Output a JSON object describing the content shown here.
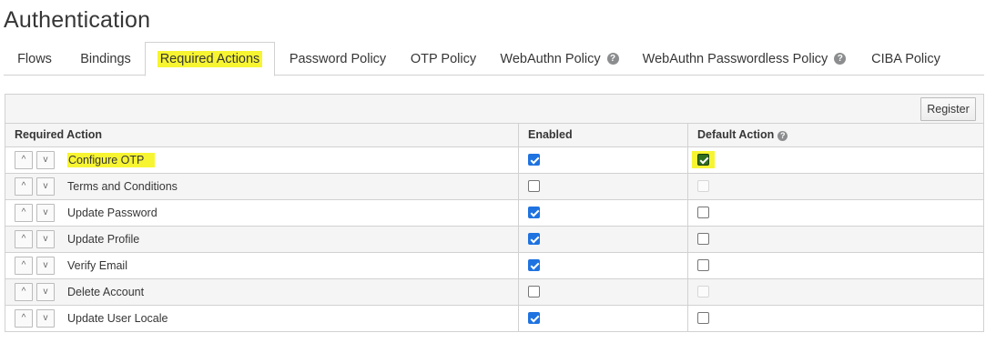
{
  "page": {
    "title": "Authentication"
  },
  "tabs": [
    {
      "label": "Flows"
    },
    {
      "label": "Bindings"
    },
    {
      "label": "Required Actions",
      "active": true
    },
    {
      "label": "Password Policy"
    },
    {
      "label": "OTP Policy"
    },
    {
      "label": "WebAuthn Policy",
      "help_icon": "question-circle-icon"
    },
    {
      "label": "WebAuthn Passwordless Policy",
      "help_icon": "question-circle-icon"
    },
    {
      "label": "CIBA Policy"
    }
  ],
  "toolbar": {
    "register_label": "Register"
  },
  "table": {
    "headers": {
      "required_action": "Required Action",
      "enabled": "Enabled",
      "default_action": "Default Action",
      "default_action_help_icon": "question-circle-icon"
    },
    "move_up_glyph": "^",
    "move_down_glyph": "v",
    "rows": [
      {
        "name": "Configure OTP",
        "enabled": true,
        "default_action": true,
        "default_disabled": false,
        "highlighted": true
      },
      {
        "name": "Terms and Conditions",
        "enabled": false,
        "default_action": false,
        "default_disabled": true
      },
      {
        "name": "Update Password",
        "enabled": true,
        "default_action": false,
        "default_disabled": false
      },
      {
        "name": "Update Profile",
        "enabled": true,
        "default_action": false,
        "default_disabled": false
      },
      {
        "name": "Verify Email",
        "enabled": true,
        "default_action": false,
        "default_disabled": false
      },
      {
        "name": "Delete Account",
        "enabled": false,
        "default_action": false,
        "default_disabled": true
      },
      {
        "name": "Update User Locale",
        "enabled": true,
        "default_action": false,
        "default_disabled": false
      }
    ]
  },
  "colors": {
    "highlight": "#f7f531",
    "checkbox_checked": "#1f73e0",
    "checkbox_default_checked": "#2f6e1f",
    "border": "#d1d1d1",
    "header_bg": "#f5f5f5"
  }
}
